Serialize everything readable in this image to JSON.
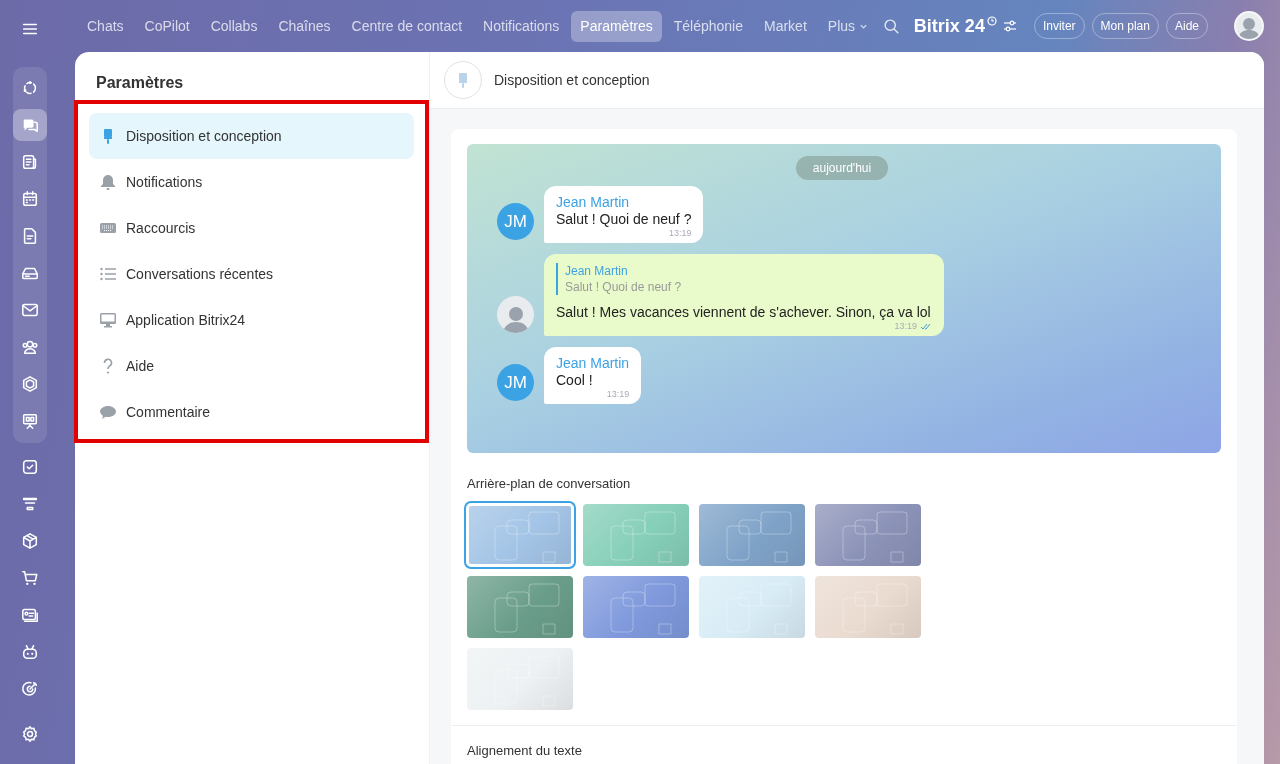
{
  "rail": [
    {
      "kind": "menu",
      "selected": false
    },
    {
      "kind": "copilot",
      "selected": false
    },
    {
      "kind": "chat",
      "selected": true
    },
    {
      "kind": "feed",
      "selected": false
    },
    {
      "kind": "calendar",
      "selected": false
    },
    {
      "kind": "document",
      "selected": false
    },
    {
      "kind": "drive",
      "selected": false
    },
    {
      "kind": "mail",
      "selected": false
    },
    {
      "kind": "people",
      "selected": false
    },
    {
      "kind": "hexagon",
      "selected": false
    },
    {
      "kind": "presentation",
      "selected": false
    },
    {
      "kind": "task",
      "selected": false
    },
    {
      "kind": "funnel",
      "selected": false
    },
    {
      "kind": "box",
      "selected": false
    },
    {
      "kind": "cart",
      "selected": false
    },
    {
      "kind": "card",
      "selected": false
    },
    {
      "kind": "robot",
      "selected": false
    },
    {
      "kind": "target",
      "selected": false
    },
    {
      "kind": "settings",
      "selected": false
    }
  ],
  "topnav": {
    "tabs": [
      {
        "label": "Chats",
        "selected": false
      },
      {
        "label": "CoPilot",
        "selected": false
      },
      {
        "label": "Collabs",
        "selected": false
      },
      {
        "label": "Chaînes",
        "selected": false
      },
      {
        "label": "Centre de contact",
        "selected": false
      },
      {
        "label": "Notifications",
        "selected": false
      },
      {
        "label": "Paramètres",
        "selected": true
      },
      {
        "label": "Téléphonie",
        "selected": false
      },
      {
        "label": "Market",
        "selected": false
      },
      {
        "label": "Plus",
        "selected": false
      }
    ],
    "brand": "Bitrix 24",
    "buttons": [
      "Inviter",
      "Mon plan",
      "Aide"
    ]
  },
  "settings_menu": {
    "title": "Paramètres",
    "items": [
      {
        "label": "Disposition et conception",
        "kind": "brush",
        "selected": true
      },
      {
        "label": "Notifications",
        "kind": "bell",
        "selected": false
      },
      {
        "label": "Raccourcis",
        "kind": "keyboard",
        "selected": false
      },
      {
        "label": "Conversations récentes",
        "kind": "list",
        "selected": false
      },
      {
        "label": "Application Bitrix24",
        "kind": "monitor",
        "selected": false
      },
      {
        "label": "Aide",
        "kind": "help",
        "selected": false
      },
      {
        "label": "Commentaire",
        "kind": "comment",
        "selected": false
      }
    ]
  },
  "content": {
    "title": "Disposition et conception",
    "preview": {
      "date": "aujourd'hui",
      "messages": [
        {
          "kind": "incoming",
          "initials": "JM",
          "author": "Jean Martin",
          "text": "Salut ! Quoi de neuf ?",
          "time": "13:19"
        },
        {
          "kind": "outgoing",
          "quote": {
            "author": "Jean Martin",
            "text": "Salut ! Quoi de neuf ?"
          },
          "text": "Salut ! Mes vacances viennent de s'achever. Sinon, ça va lol",
          "time": "13:19",
          "read": true
        },
        {
          "kind": "incoming",
          "initials": "JM",
          "author": "Jean Martin",
          "text": "Cool !",
          "time": "13:19"
        }
      ]
    },
    "backgrounds_label": "Arrière-plan de conversation",
    "backgrounds": [
      {
        "color": "#a3c4e6",
        "selected": true
      },
      {
        "color": "#86cfb8",
        "selected": false
      },
      {
        "color": "#7fa3c8",
        "selected": false
      },
      {
        "color": "#8c93b8",
        "selected": false
      },
      {
        "color": "#6a9e8a",
        "selected": false
      },
      {
        "color": "#7f99dc",
        "selected": false
      },
      {
        "color": "#d8ecf6",
        "selected": false
      },
      {
        "color": "#eadbd0",
        "selected": false
      },
      {
        "color": "#eef1f3",
        "selected": false
      }
    ],
    "alignment_label": "Alignement du texte"
  }
}
